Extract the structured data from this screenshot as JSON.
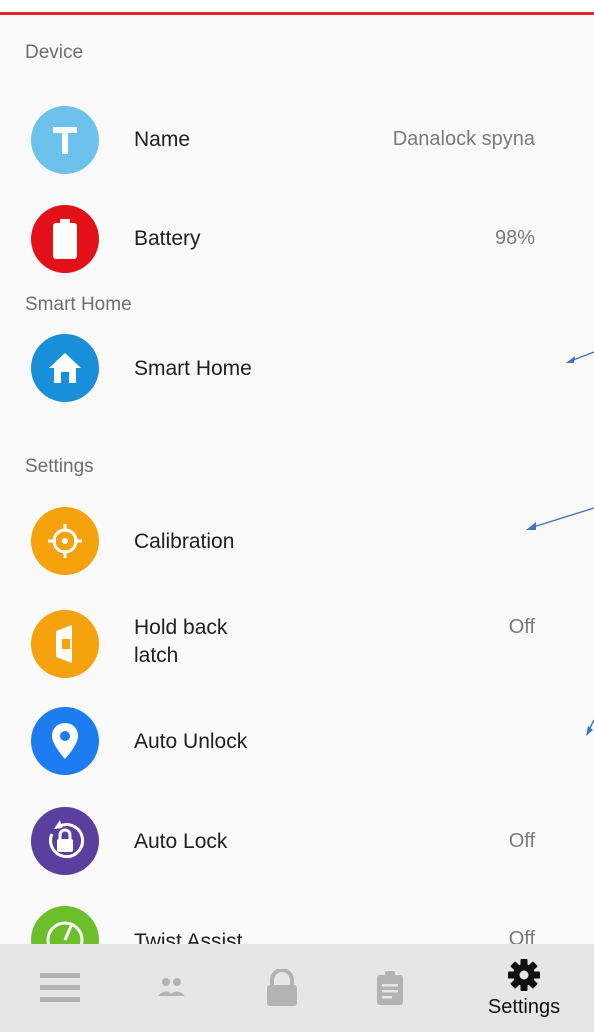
{
  "sections": {
    "device": "Device",
    "smart_home": "Smart Home",
    "settings": "Settings"
  },
  "rows": {
    "name": {
      "label": "Name",
      "value": "Danalock spyna",
      "icon": "name-t-icon",
      "color": "#6cc2ec"
    },
    "battery": {
      "label": "Battery",
      "value": "98%",
      "icon": "battery-icon",
      "color": "#e3101a"
    },
    "smart_home": {
      "label": "Smart Home",
      "icon": "home-icon",
      "color": "#1a8fd9"
    },
    "calibration": {
      "label": "Calibration",
      "icon": "crosshair-icon",
      "color": "#f5a20c"
    },
    "hold_back": {
      "label_line1": "Hold back",
      "label_line2": "latch",
      "value": "Off",
      "icon": "latch-icon",
      "color": "#f5a20c"
    },
    "auto_unlock": {
      "label": "Auto Unlock",
      "icon": "location-pin-icon",
      "color": "#1d7df0"
    },
    "auto_lock": {
      "label": "Auto Lock",
      "value": "Off",
      "icon": "auto-lock-icon",
      "color": "#5a3f9e"
    },
    "twist_assist": {
      "label": "Twist Assist",
      "value": "Off",
      "icon": "twist-assist-icon",
      "color": "#6cbf2a"
    }
  },
  "bottom_nav": {
    "items": [
      {
        "icon": "menu-icon"
      },
      {
        "icon": "users-icon"
      },
      {
        "icon": "lock-icon"
      },
      {
        "icon": "clipboard-icon"
      },
      {
        "icon": "gear-icon",
        "label": "Settings"
      }
    ]
  },
  "colors": {
    "accent_bar": "#e3242b",
    "arrow": "#4472c4"
  }
}
